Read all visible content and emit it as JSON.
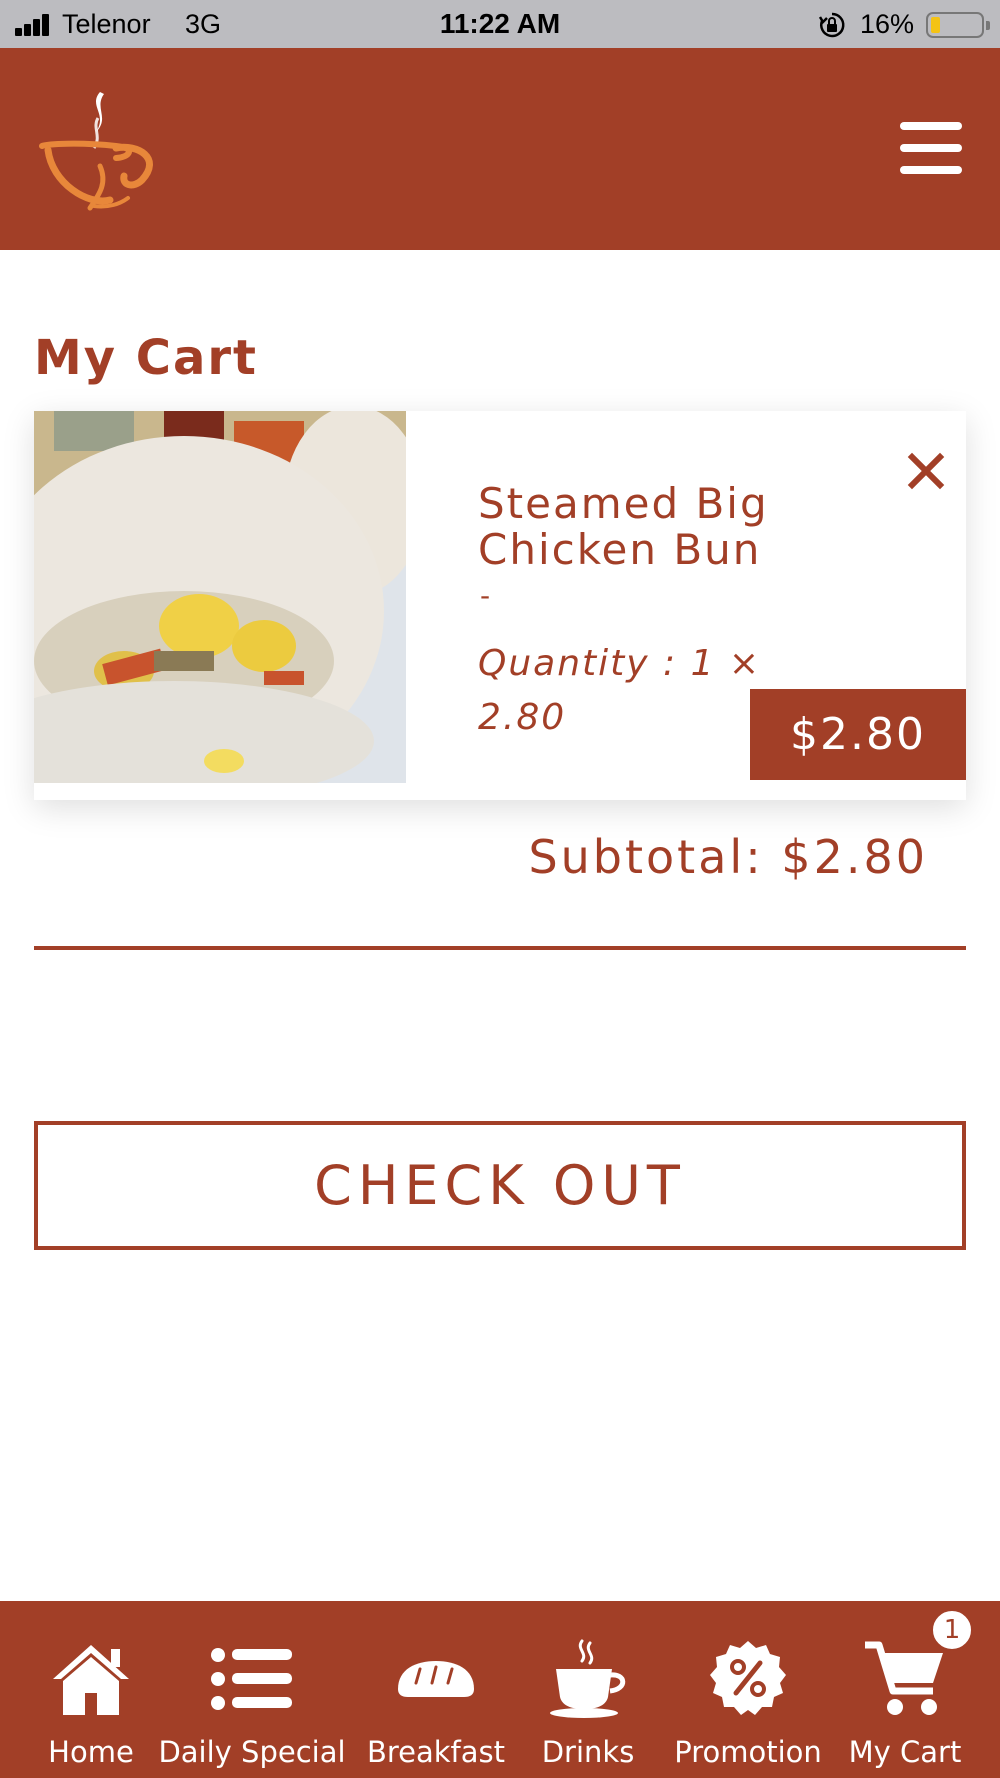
{
  "status_bar": {
    "carrier": "Telenor",
    "network": "3G",
    "time": "11:22 AM",
    "battery": "16%",
    "battery_level": 0.16
  },
  "header": {
    "logo_icon": "coffee-cup-logo",
    "menu_icon": "hamburger-menu-icon"
  },
  "page": {
    "title": "My Cart"
  },
  "cart": {
    "items": [
      {
        "name": "Steamed Big Chicken Bun",
        "dash": "-",
        "quantity_text": "Quantity : 1 × 2.80",
        "price": "$2.80",
        "image_icon": "steamed-bun-photo"
      }
    ],
    "subtotal": "Subtotal: $2.80"
  },
  "checkout": {
    "label": "CHECK OUT"
  },
  "bottom_nav": {
    "items": [
      {
        "label": "Home",
        "icon": "home-icon"
      },
      {
        "label": "Daily Special",
        "icon": "list-icon"
      },
      {
        "label": "Breakfast",
        "icon": "bread-icon"
      },
      {
        "label": "Drinks",
        "icon": "coffee-cup-icon"
      },
      {
        "label": "Promotion",
        "icon": "percent-badge-icon"
      },
      {
        "label": "My Cart",
        "icon": "shopping-cart-icon"
      }
    ],
    "cart_count": "1"
  },
  "colors": {
    "brand": "#a23f27",
    "status_bar": "#bcbcc0",
    "logo_orange": "#e8873a"
  }
}
